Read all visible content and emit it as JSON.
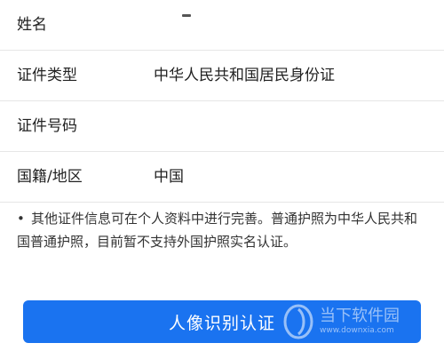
{
  "form": {
    "rows": [
      {
        "label": "姓名",
        "value": ""
      },
      {
        "label": "证件类型",
        "value": "中华人民共和国居民身份证"
      },
      {
        "label": "证件号码",
        "value": ""
      },
      {
        "label": "国籍/地区",
        "value": "中国"
      }
    ]
  },
  "notice": {
    "bullet": "•",
    "text": "其他证件信息可在个人资料中进行完善。普通护照为中华人民共和国普通护照，目前暂不支持外国护照实名认证。"
  },
  "button": {
    "label": "人像识别认证"
  },
  "watermark": {
    "brand": "当下软件园",
    "url": "www.downxia.com"
  },
  "colors": {
    "primary": "#1a73f0",
    "divider": "#e6e6e6",
    "text": "#222222"
  }
}
